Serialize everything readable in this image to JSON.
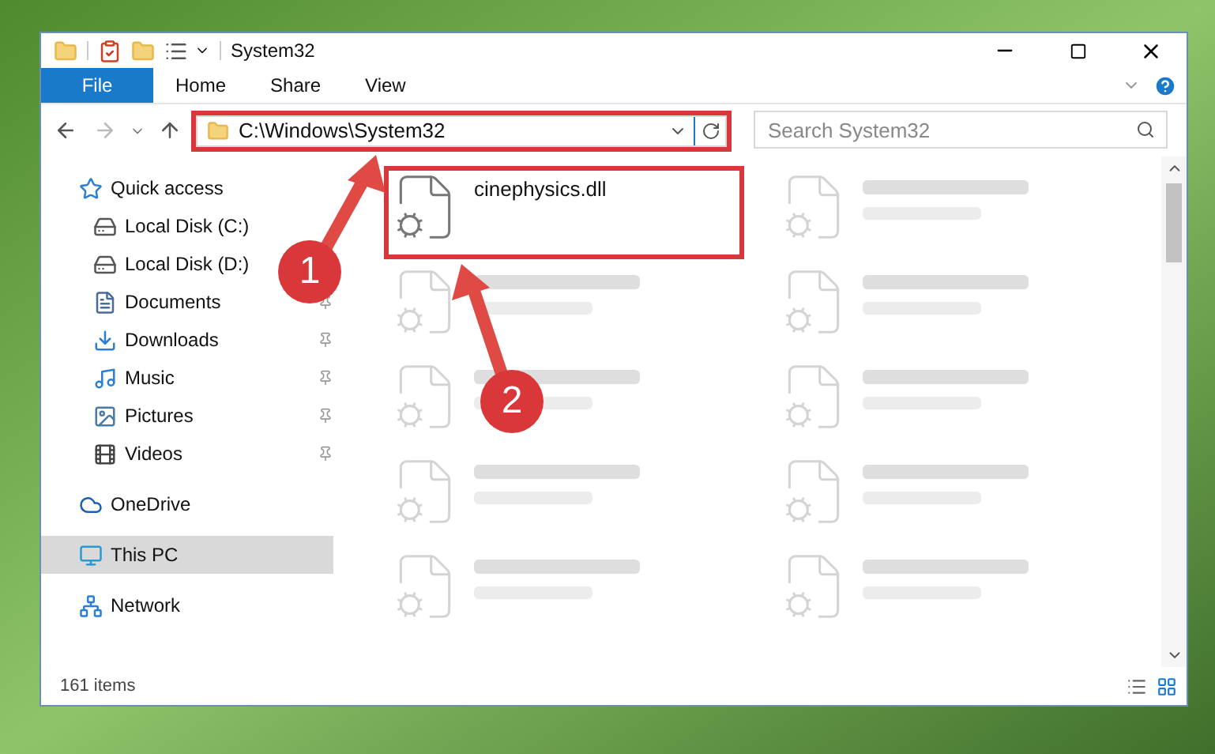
{
  "window": {
    "title": "System32"
  },
  "ribbon": {
    "tabs": [
      {
        "label": "File",
        "kind": "menu"
      },
      {
        "label": "Home",
        "kind": "tab"
      },
      {
        "label": "Share",
        "kind": "tab"
      },
      {
        "label": "View",
        "kind": "tab"
      }
    ]
  },
  "address_bar": {
    "path": "C:\\Windows\\System32",
    "highlighted": true
  },
  "search": {
    "placeholder": "Search System32"
  },
  "sidebar": {
    "items": [
      {
        "label": "Quick access",
        "kind": "star",
        "selected": false,
        "children": [
          {
            "label": "Local Disk (C:)",
            "kind": "drive",
            "pinned": false,
            "selected": false
          },
          {
            "label": "Local Disk (D:)",
            "kind": "drive",
            "selected": false
          },
          {
            "label": "Documents",
            "kind": "document",
            "pinned": true,
            "selected": false
          },
          {
            "label": "Downloads",
            "kind": "download",
            "pinned": true,
            "selected": false
          },
          {
            "label": "Music",
            "kind": "music",
            "pinned": true,
            "selected": false
          },
          {
            "label": "Pictures",
            "kind": "picture",
            "pinned": true,
            "selected": false
          },
          {
            "label": "Videos",
            "kind": "video",
            "pinned": true,
            "selected": false
          }
        ]
      },
      {
        "label": "OneDrive",
        "kind": "cloud",
        "selected": false
      },
      {
        "label": "This PC",
        "kind": "computer",
        "selected": true
      },
      {
        "label": "Network",
        "kind": "network",
        "selected": false
      }
    ]
  },
  "files": [
    {
      "name": "cinephysics.dll",
      "blurred": false,
      "highlighted": true
    },
    {
      "blurred": true
    },
    {
      "blurred": true
    },
    {
      "blurred": true
    },
    {
      "blurred": true
    },
    {
      "blurred": true
    },
    {
      "blurred": true
    },
    {
      "blurred": true
    },
    {
      "blurred": true
    },
    {
      "blurred": true
    }
  ],
  "status_bar": {
    "count": "161 items"
  },
  "annotations": [
    {
      "number": "1"
    },
    {
      "number": "2"
    }
  ]
}
